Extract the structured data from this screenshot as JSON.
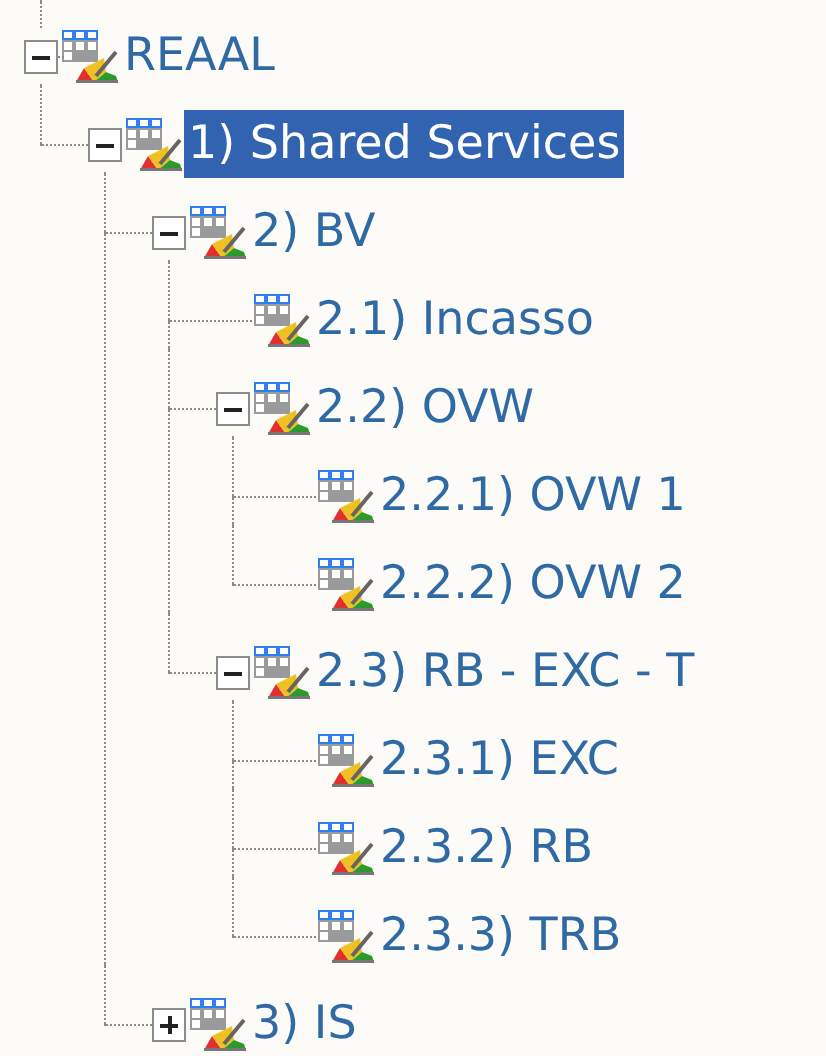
{
  "tree": [
    {
      "label": "REAAL",
      "expanded": true,
      "selected": false,
      "children": [
        {
          "label": "1) Shared Services",
          "expanded": true,
          "selected": true,
          "children": [
            {
              "label": "2) BV",
              "expanded": true,
              "selected": false,
              "children": [
                {
                  "label": "2.1) Incasso",
                  "selected": false
                },
                {
                  "label": "2.2) OVW",
                  "expanded": true,
                  "selected": false,
                  "children": [
                    {
                      "label": "2.2.1) OVW 1",
                      "selected": false
                    },
                    {
                      "label": "2.2.2) OVW 2",
                      "selected": false
                    }
                  ]
                },
                {
                  "label": "2.3) RB - EXC - T",
                  "expanded": true,
                  "selected": false,
                  "children": [
                    {
                      "label": "2.3.1) EXC",
                      "selected": false
                    },
                    {
                      "label": "2.3.2) RB",
                      "selected": false
                    },
                    {
                      "label": "2.3.3) TRB",
                      "selected": false
                    }
                  ]
                }
              ]
            },
            {
              "label": "3) IS",
              "expanded": false,
              "selected": false
            }
          ]
        }
      ]
    }
  ]
}
